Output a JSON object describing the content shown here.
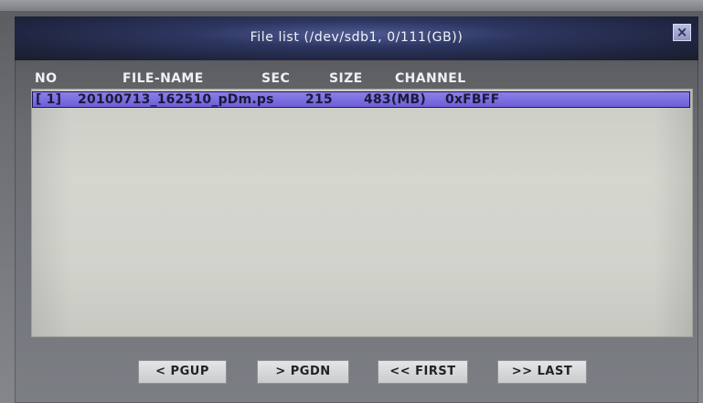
{
  "window": {
    "title": "File list (/dev/sdb1, 0/111(GB))",
    "close_label": "×"
  },
  "columns": {
    "no": "NO",
    "file_name": "FILE-NAME",
    "sec": "SEC",
    "size": "SIZE",
    "channel": "CHANNEL"
  },
  "rows": [
    {
      "no": "[ 1]",
      "file_name": "20100713_162510_pDm.ps",
      "sec": "215",
      "size": "483(MB)",
      "channel": "0xFBFF"
    }
  ],
  "buttons": {
    "pgup": "< PGUP",
    "pgdn": "> PGDN",
    "first": "<< FIRST",
    "last": ">> LAST"
  },
  "colors": {
    "title_bar": "#2d3660",
    "selected_row": "#7a6de0",
    "list_background": "#d1d3cc"
  }
}
